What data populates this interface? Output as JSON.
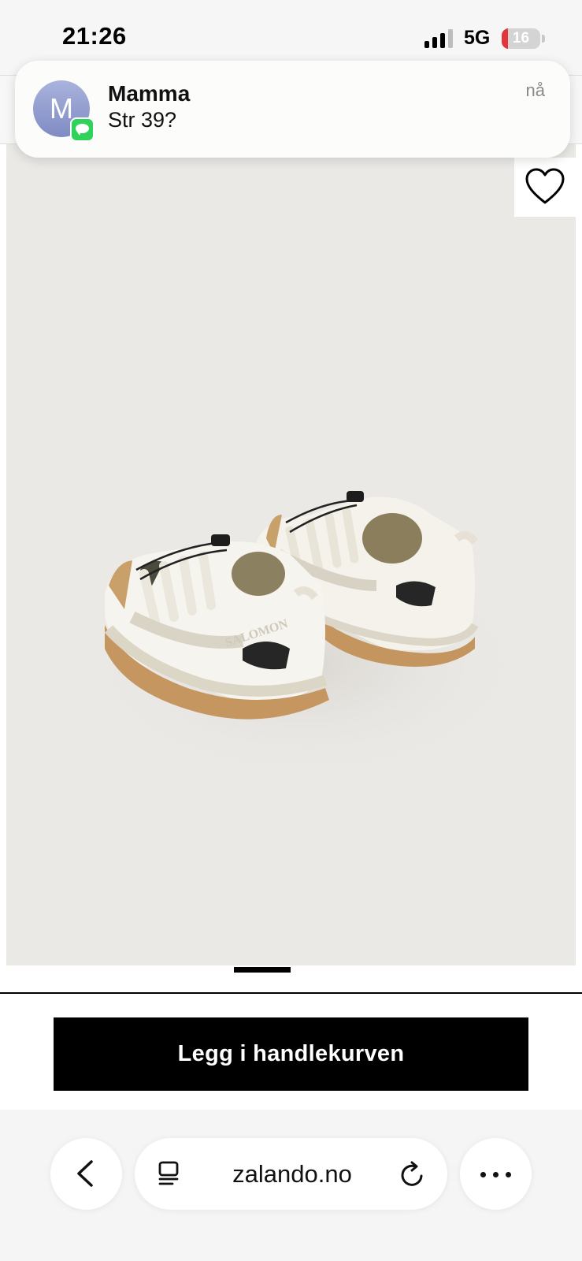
{
  "status_bar": {
    "time": "21:26",
    "network": "5G",
    "battery_level": "16",
    "battery_fraction": 0.16,
    "signal_bars_active": 3,
    "signal_bars_total": 4
  },
  "notification": {
    "app": "Messages",
    "avatar_initial": "M",
    "sender": "Mamma",
    "message": "Str 39?",
    "time": "nå"
  },
  "product": {
    "image_subject": "white Salomon sneakers",
    "brand_text_on_shoe": "SALOMON",
    "wishlist_icon": "heart-outline-icon"
  },
  "cart": {
    "add_to_cart_label": "Legg i handlekurven"
  },
  "browser": {
    "url": "zalando.no",
    "icons": {
      "back": "chevron-left-icon",
      "tabs": "tabs-icon",
      "reload": "reload-icon",
      "more": "ellipsis-icon"
    }
  },
  "colors": {
    "image_background": "#ebe9e6",
    "button_background": "#000000",
    "button_text": "#ffffff",
    "battery_low": "#e5333b",
    "messages_green": "#2fd35a"
  }
}
